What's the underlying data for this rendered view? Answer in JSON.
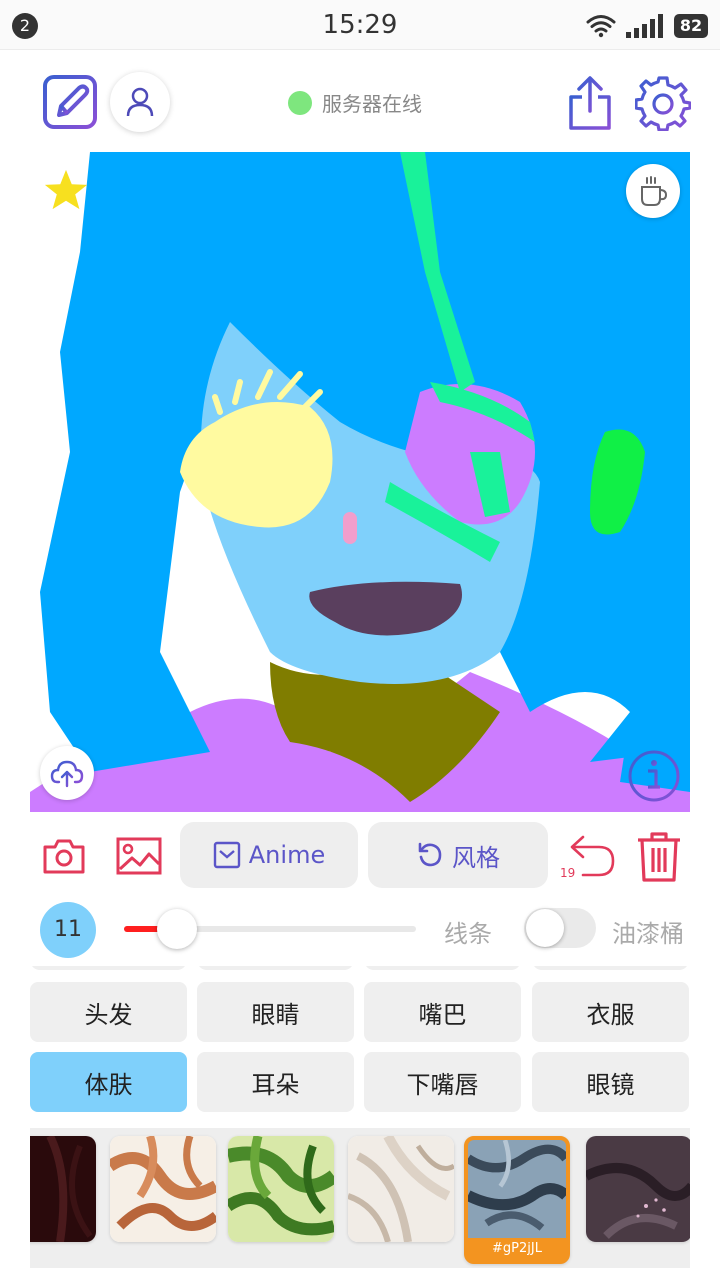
{
  "status_bar": {
    "notification_count": "2",
    "time": "15:29",
    "battery": "82",
    "icons": [
      "wifi-icon",
      "signal-icon",
      "battery-icon"
    ]
  },
  "toolbar": {
    "server_status": "服务器在线",
    "server_status_color": "#7ee67e",
    "icons": [
      "sketch-edit-icon",
      "user-icon",
      "share-icon",
      "settings-icon"
    ]
  },
  "canvas": {
    "overlay_icons": [
      "star-icon",
      "coffee-icon",
      "cloud-upload-icon",
      "info-icon"
    ],
    "palette": {
      "hair": "#00a8ff",
      "skin": "#7fd0fb",
      "eye": "#fffaa0",
      "mouth": "#5a3f5e",
      "neck": "#807d00",
      "clothes": "#cc7cff",
      "accent_green": "#19f29a",
      "ear": "#10f046"
    }
  },
  "actions": {
    "camera": "camera-icon",
    "gallery": "image-icon",
    "anime_label": "Anime",
    "style_label": "风格",
    "undo_count": "19",
    "delete": "trash-icon"
  },
  "brush": {
    "size": "11",
    "size_fraction": 0.18,
    "line_label": "线条",
    "bucket_label": "油漆桶",
    "bucket_enabled": false
  },
  "tags": [
    {
      "label": "头发",
      "active": false
    },
    {
      "label": "眼睛",
      "active": false
    },
    {
      "label": "嘴巴",
      "active": false
    },
    {
      "label": "衣服",
      "active": false
    },
    {
      "label": "体肤",
      "active": true
    },
    {
      "label": "耳朵",
      "active": false
    },
    {
      "label": "下嘴唇",
      "active": false
    },
    {
      "label": "眼镜",
      "active": false
    }
  ],
  "textures": {
    "selected_code": "#gP2jJL",
    "items": [
      "texture-dark-red",
      "texture-copper-veins",
      "texture-green-leaves",
      "texture-cream-feathers",
      "texture-blue-grey-scales",
      "texture-dark-purple-bokeh"
    ]
  }
}
